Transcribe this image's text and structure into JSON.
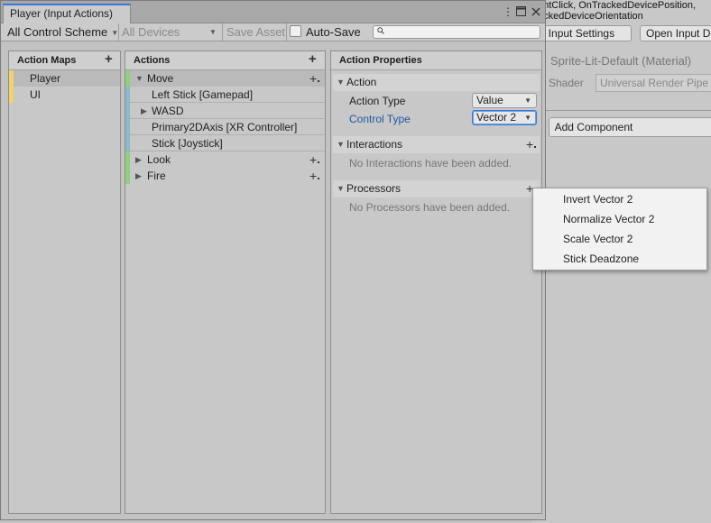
{
  "background_inspector": {
    "info_line_1": "ghtClick, OnTrackedDevicePosition,",
    "info_line_2": "ackedDeviceOrientation",
    "open_input_settings": "en Input Settings",
    "open_input_debugger": "Open Input D",
    "material_name": "Sprite-Lit-Default (Material)",
    "shader_label": "Shader",
    "shader_value": "Universal Render Pipe",
    "add_component": "Add Component"
  },
  "window": {
    "tab_title": "Player (Input Actions)",
    "icons": {
      "menu": "more-vertical-icon",
      "maximize": "maximize-icon",
      "close": "close-icon"
    }
  },
  "toolbar": {
    "control_scheme": "All Control Scheme",
    "devices": "All Devices",
    "save_asset": "Save Asset",
    "auto_save": "Auto-Save",
    "auto_save_checked": false,
    "search_placeholder": ""
  },
  "action_maps": {
    "header": "Action Maps",
    "items": [
      {
        "label": "Player",
        "selected": true
      },
      {
        "label": "UI",
        "selected": false
      }
    ]
  },
  "actions": {
    "header": "Actions",
    "items": [
      {
        "label": "Move",
        "kind": "action",
        "expanded": true
      },
      {
        "label": "Left Stick [Gamepad]",
        "kind": "binding"
      },
      {
        "label": "WASD",
        "kind": "composite"
      },
      {
        "label": "Primary2DAxis [XR Controller]",
        "kind": "binding"
      },
      {
        "label": "Stick [Joystick]",
        "kind": "binding"
      },
      {
        "label": "Look",
        "kind": "action",
        "expanded": false
      },
      {
        "label": "Fire",
        "kind": "action",
        "expanded": false
      }
    ],
    "colors": {
      "action": "#8fcf7f",
      "binding": "#8fb8c8"
    }
  },
  "properties": {
    "header": "Action Properties",
    "action_section": "Action",
    "action_type_label": "Action Type",
    "action_type_value": "Value",
    "control_type_label": "Control Type",
    "control_type_value": "Vector 2",
    "interactions_section": "Interactions",
    "interactions_empty": "No Interactions have been added.",
    "processors_section": "Processors",
    "processors_empty": "No Processors have been added."
  },
  "processor_menu": {
    "items": [
      "Invert Vector 2",
      "Normalize Vector 2",
      "Scale Vector 2",
      "Stick Deadzone"
    ]
  }
}
